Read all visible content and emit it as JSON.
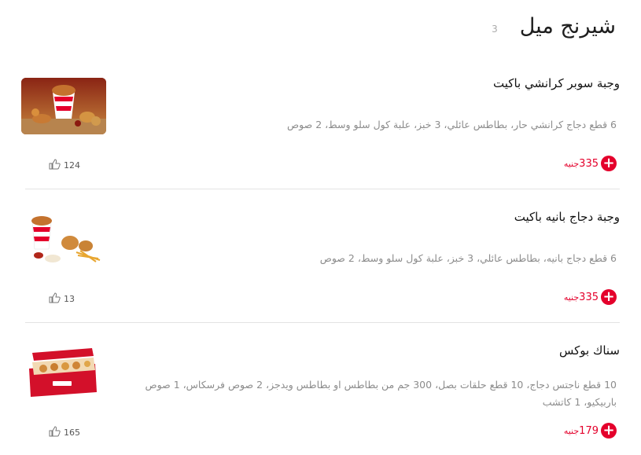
{
  "section": {
    "title": "شيرنج ميل",
    "count": "3"
  },
  "currency": "جنيه",
  "items": [
    {
      "name": "وجبة سوبر كرانشي باكيت",
      "description": "6 قطع دجاج كرانشي حار، بطاطس عائلي، 3 خبز، علبة كول سلو وسط، 2 صوص",
      "price": "335",
      "likes": "124",
      "image_icon": "chicken-bucket-meal-image"
    },
    {
      "name": "وجبة دجاج بانيه باكيت",
      "description": "6 قطع دجاج بانيه، بطاطس عائلي، 3 خبز، علبة كول سلو وسط، 2 صوص",
      "price": "335",
      "likes": "13",
      "image_icon": "pane-bucket-meal-image"
    },
    {
      "name": "سناك بوكس",
      "description": "10 قطع ناجتس دجاج، 10 قطع حلقات بصل، 300 جم من بطاطس او بطاطس ويدجز، 2 صوص فرسكاس، 1 صوص باربيكيو، 1 كاتشب",
      "price": "179",
      "likes": "165",
      "image_icon": "snacks-box-image"
    }
  ],
  "colors": {
    "accent": "#e4002b",
    "divider": "#e3e3e3",
    "muted": "#8c8c8c"
  }
}
